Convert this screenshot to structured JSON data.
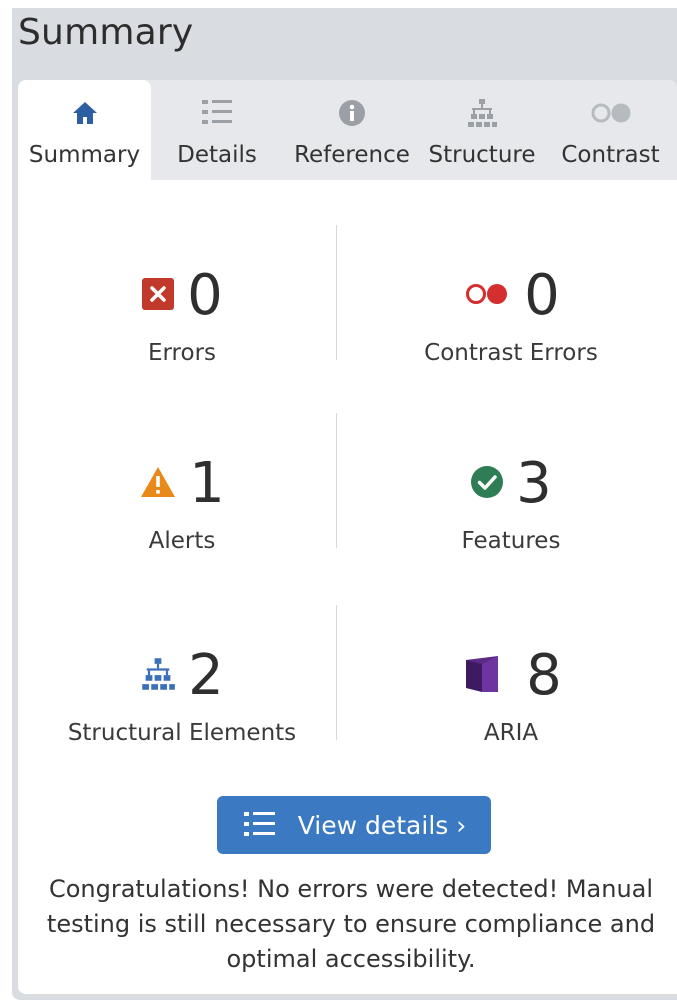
{
  "header": {
    "title": "Summary"
  },
  "tabs": [
    {
      "label": "Summary",
      "icon": "home-icon",
      "active": true
    },
    {
      "label": "Details",
      "icon": "list-icon",
      "active": false
    },
    {
      "label": "Reference",
      "icon": "info-icon",
      "active": false
    },
    {
      "label": "Structure",
      "icon": "structure-icon",
      "active": false
    },
    {
      "label": "Contrast",
      "icon": "contrast-icon",
      "active": false
    }
  ],
  "stats": {
    "errors": {
      "value": "0",
      "label": "Errors",
      "icon": "error-icon",
      "color": "#c0392b"
    },
    "contrast_errors": {
      "value": "0",
      "label": "Contrast Errors",
      "icon": "contrast-error-icon",
      "color": "#d32f2f"
    },
    "alerts": {
      "value": "1",
      "label": "Alerts",
      "icon": "alert-icon",
      "color": "#e8891a"
    },
    "features": {
      "value": "3",
      "label": "Features",
      "icon": "feature-check-icon",
      "color": "#2e7d55"
    },
    "structural": {
      "value": "2",
      "label": "Structural Elements",
      "icon": "structure-icon",
      "color": "#3b6fb8"
    },
    "aria": {
      "value": "8",
      "label": "ARIA",
      "icon": "aria-icon",
      "color": "#5b2a86"
    }
  },
  "view_details": {
    "label": "View details ›",
    "icon": "list-icon",
    "color": "#3b79c3"
  },
  "message": "Congratulations! No errors were detected! Manual testing is still necessary to ensure compliance and optimal accessibility."
}
